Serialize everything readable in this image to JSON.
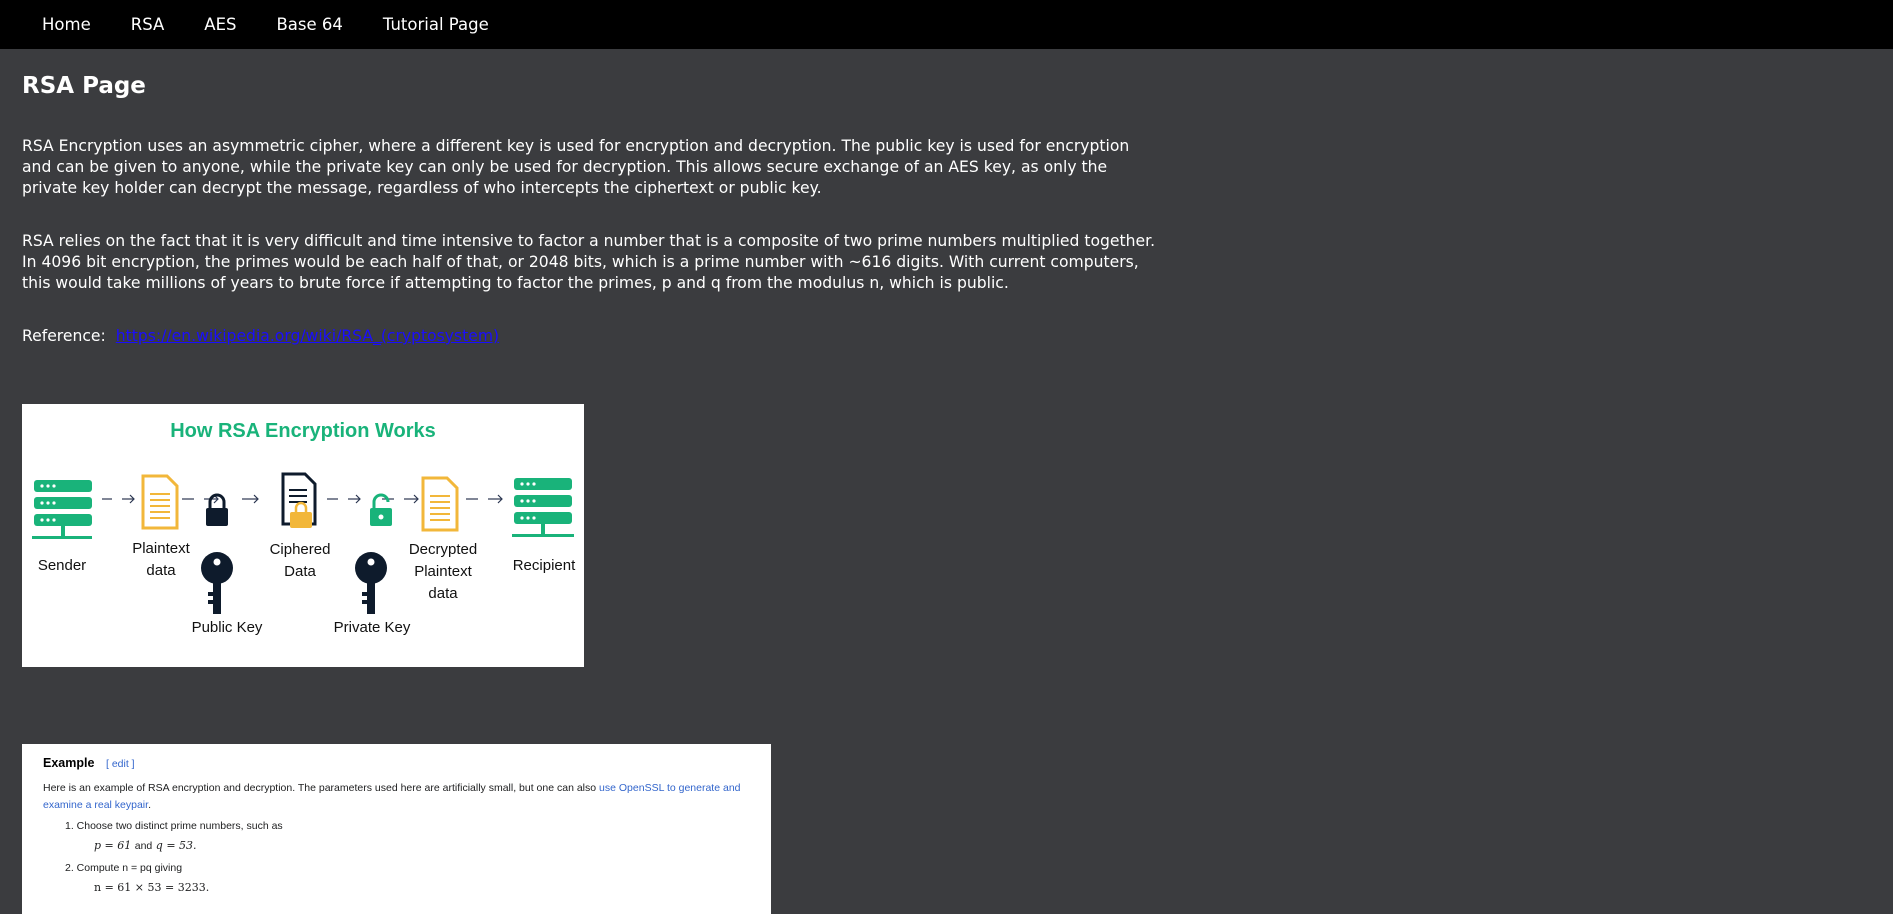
{
  "nav": {
    "items": [
      "Home",
      "RSA",
      "AES",
      "Base 64",
      "Tutorial Page"
    ]
  },
  "page": {
    "title": "RSA Page",
    "para1": "RSA Encryption uses an asymmetric cipher, where a different key is used for encryption and decryption. The public key is used for encryption and can be given to anyone, while the private key can only be used for decryption. This allows secure exchange of an AES key, as only the private key holder can decrypt the message, regardless of who intercepts the ciphertext or public key.",
    "para2": "RSA relies on the fact that it is very difficult and time intensive to factor a number that is a composite of two prime numbers multiplied together. In 4096 bit encryption, the primes would be each half of that, or 2048 bits, which is a prime number with ~616 digits. With current computers, this would take millions of years to brute force if attempting to factor the primes, p and q from the modulus n, which is public.",
    "reference_label": "Reference:",
    "reference_link": "https://en.wikipedia.org/wiki/RSA_(cryptosystem)"
  },
  "diagram": {
    "title": "How RSA Encryption Works",
    "labels": {
      "sender": "Sender",
      "plaintext": "Plaintext\ndata",
      "ciphered": "Ciphered\nData",
      "decrypted": "Decrypted\nPlaintext\ndata",
      "recipient": "Recipient",
      "public_key": "Public Key",
      "private_key": "Private Key"
    },
    "colors": {
      "green": "#19b37a",
      "gold": "#f2b73a",
      "navy": "#0e1b2c"
    }
  },
  "example": {
    "heading": "Example",
    "edit": "[ edit ]",
    "intro": "Here is an example of RSA encryption and decryption. The parameters used here are artificially small, but one can also",
    "intro_link": "use OpenSSL to generate and examine a real keypair",
    "intro_end": ".",
    "step1": "1. Choose two distinct prime numbers, such as",
    "step1_math_p": "p = 61",
    "step1_math_and": "and",
    "step1_math_q": "q = 53.",
    "step2": "2. Compute n = pq giving",
    "step2_math": "n = 61 × 53 = 3233."
  }
}
